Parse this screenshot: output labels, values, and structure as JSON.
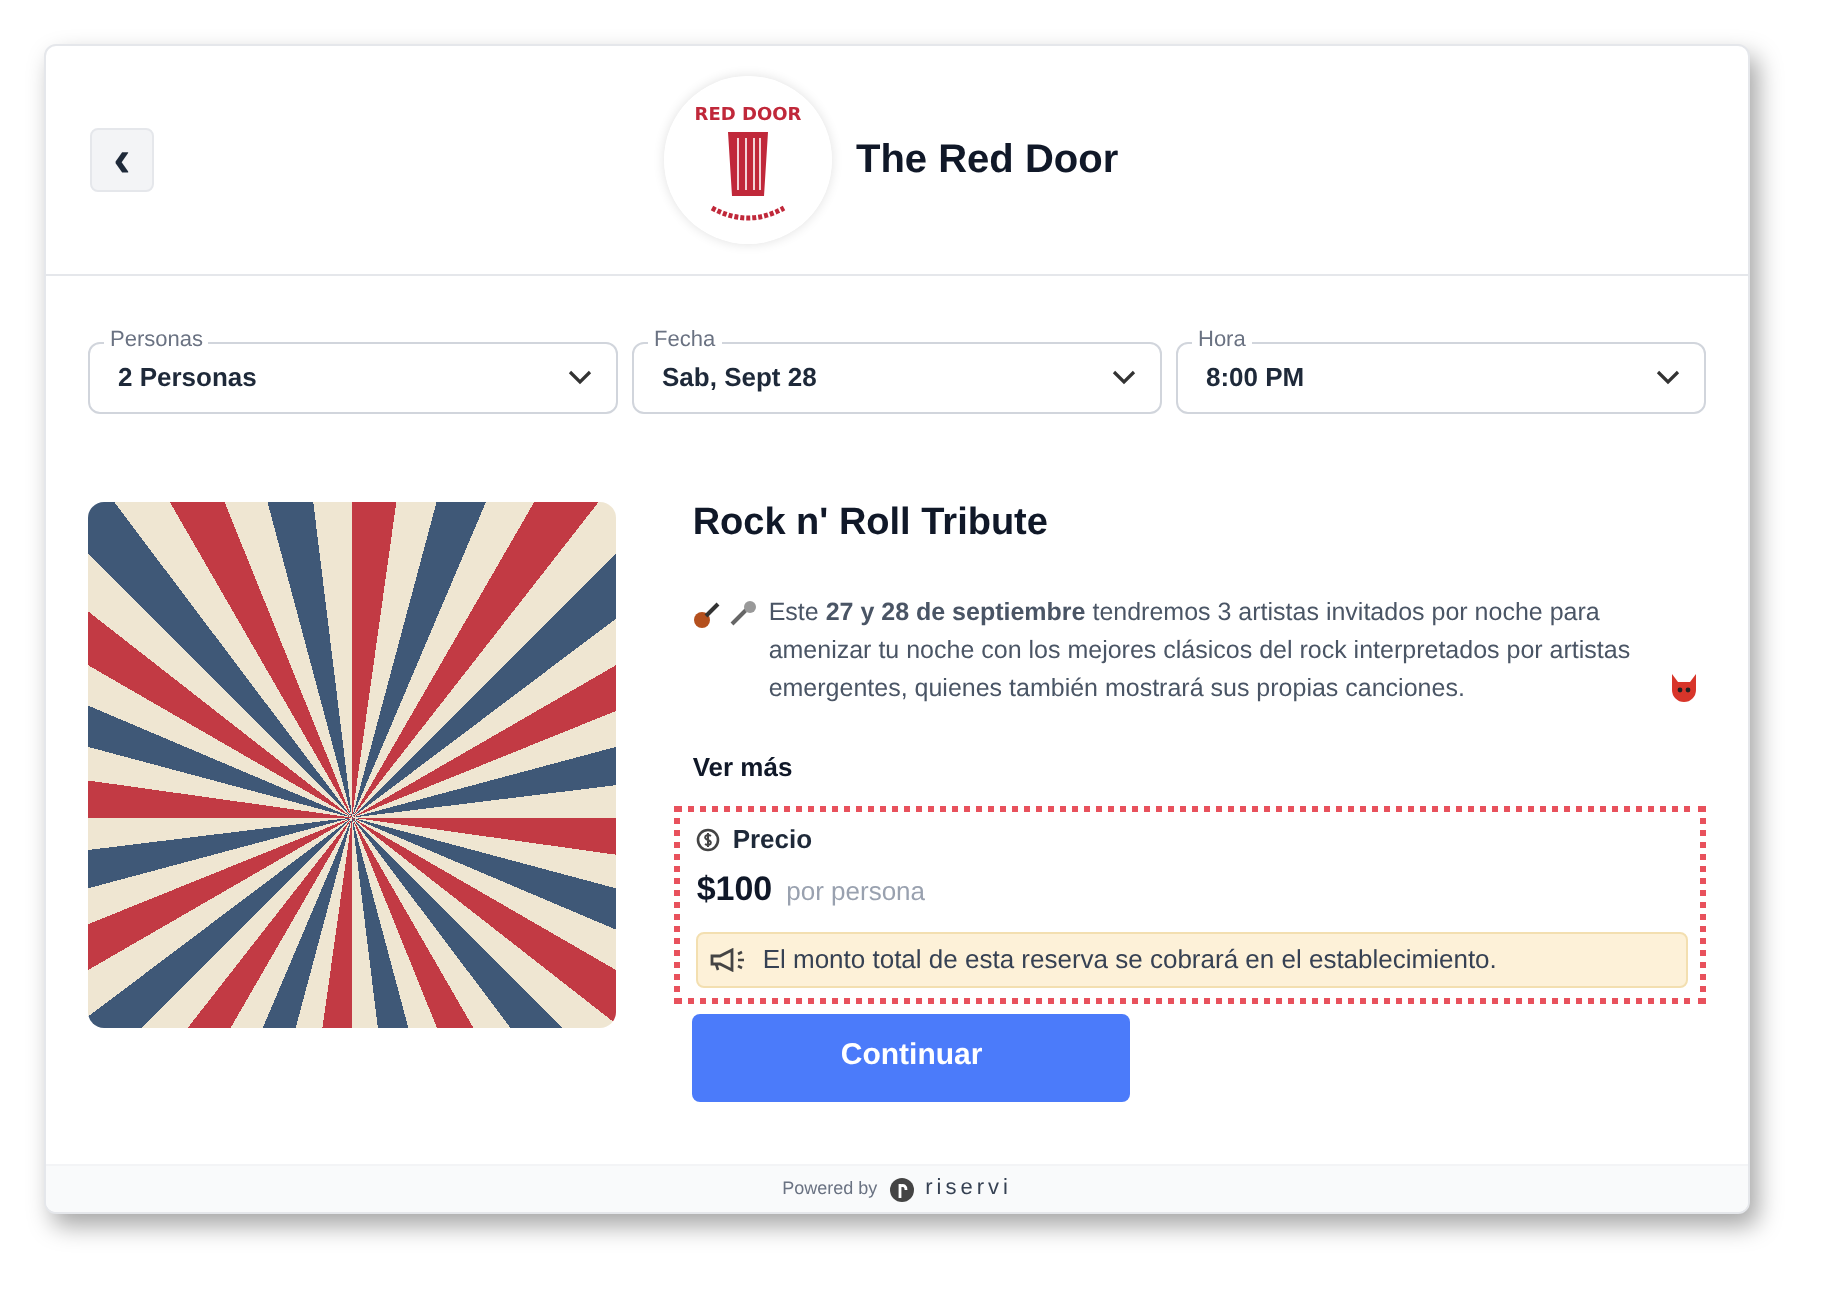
{
  "header": {
    "back_label": "‹",
    "logo_text": "RED DOOR",
    "venue_name": "The Red Door"
  },
  "selectors": [
    {
      "label": "Personas",
      "value": "2 Personas"
    },
    {
      "label": "Fecha",
      "value": "Sab, Sept 28"
    },
    {
      "label": "Hora",
      "value": "8:00 PM"
    }
  ],
  "event": {
    "title": "Rock n' Roll Tribute",
    "description": "Este **27 y 28 de septiembre** tendremos 3 artistas invitados por noche para amenizar tu noche con los mejores clásicos del rock interpretados por artistas emergentes, quienes también mostrará sus propias canciones.",
    "more_link": "Ver más"
  },
  "price": {
    "heading": "Precio",
    "amount": "$100",
    "unit": "por persona",
    "notice": "El monto total de esta reserva se cobrará en el establecimiento.",
    "highlighted": true
  },
  "continue_button": "Continuar",
  "footer": {
    "powered_by": "Powered by",
    "brand": "riservi"
  }
}
